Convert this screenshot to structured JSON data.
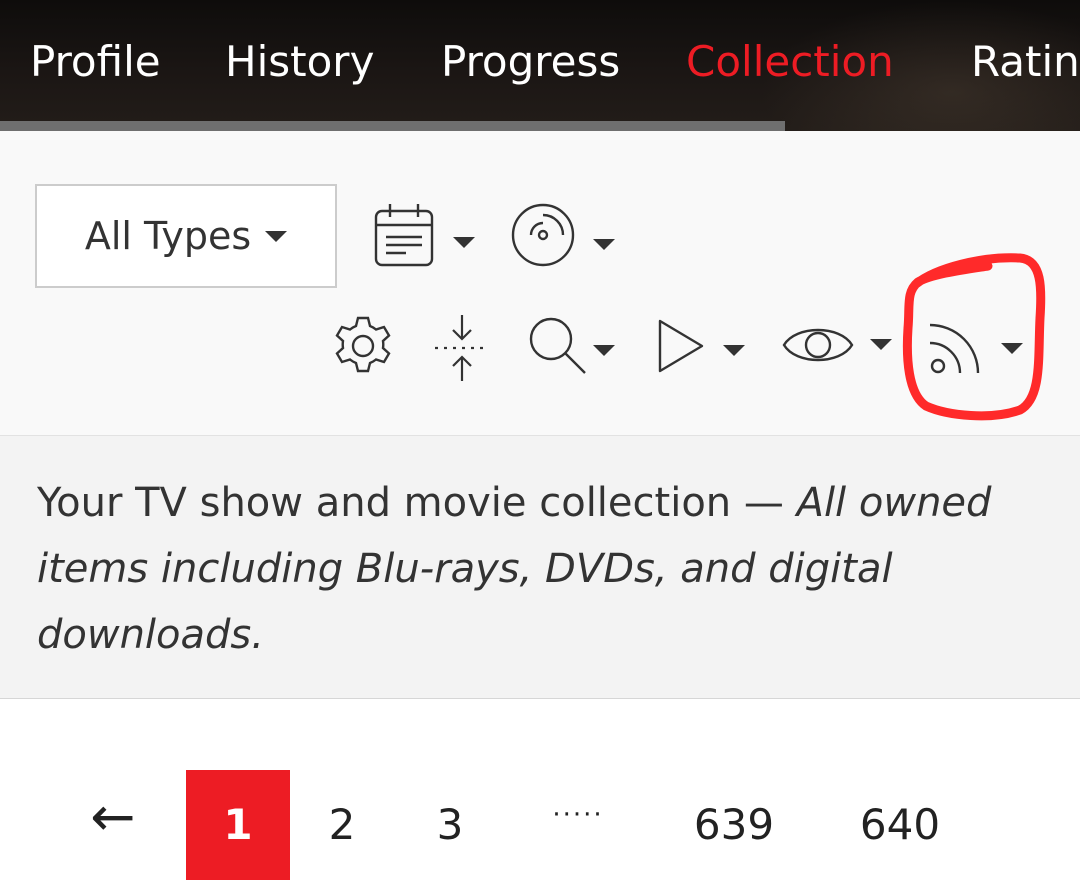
{
  "nav": {
    "tabs": [
      {
        "label": "Profile",
        "active": false
      },
      {
        "label": "History",
        "active": false
      },
      {
        "label": "Progress",
        "active": false
      },
      {
        "label": "Collection",
        "active": true
      },
      {
        "label": "Ratin",
        "active": false
      }
    ]
  },
  "toolbar": {
    "type_select": "All Types",
    "icons": [
      "calendar-icon",
      "disc-icon",
      "gear-icon",
      "collapse-icon",
      "search-icon",
      "play-icon",
      "eye-icon",
      "rss-icon"
    ]
  },
  "description": {
    "lead": "Your TV show and movie collection — ",
    "italic": "All owned items including Blu-rays, DVDs, and digital downloads."
  },
  "pagination": {
    "prev": "←",
    "pages": [
      "1",
      "2",
      "3",
      "·····",
      "639",
      "640"
    ],
    "current": "1"
  },
  "colors": {
    "accent": "#ed1c24",
    "nav_bg": "#1b1614",
    "annotation": "#ff2a2a"
  }
}
